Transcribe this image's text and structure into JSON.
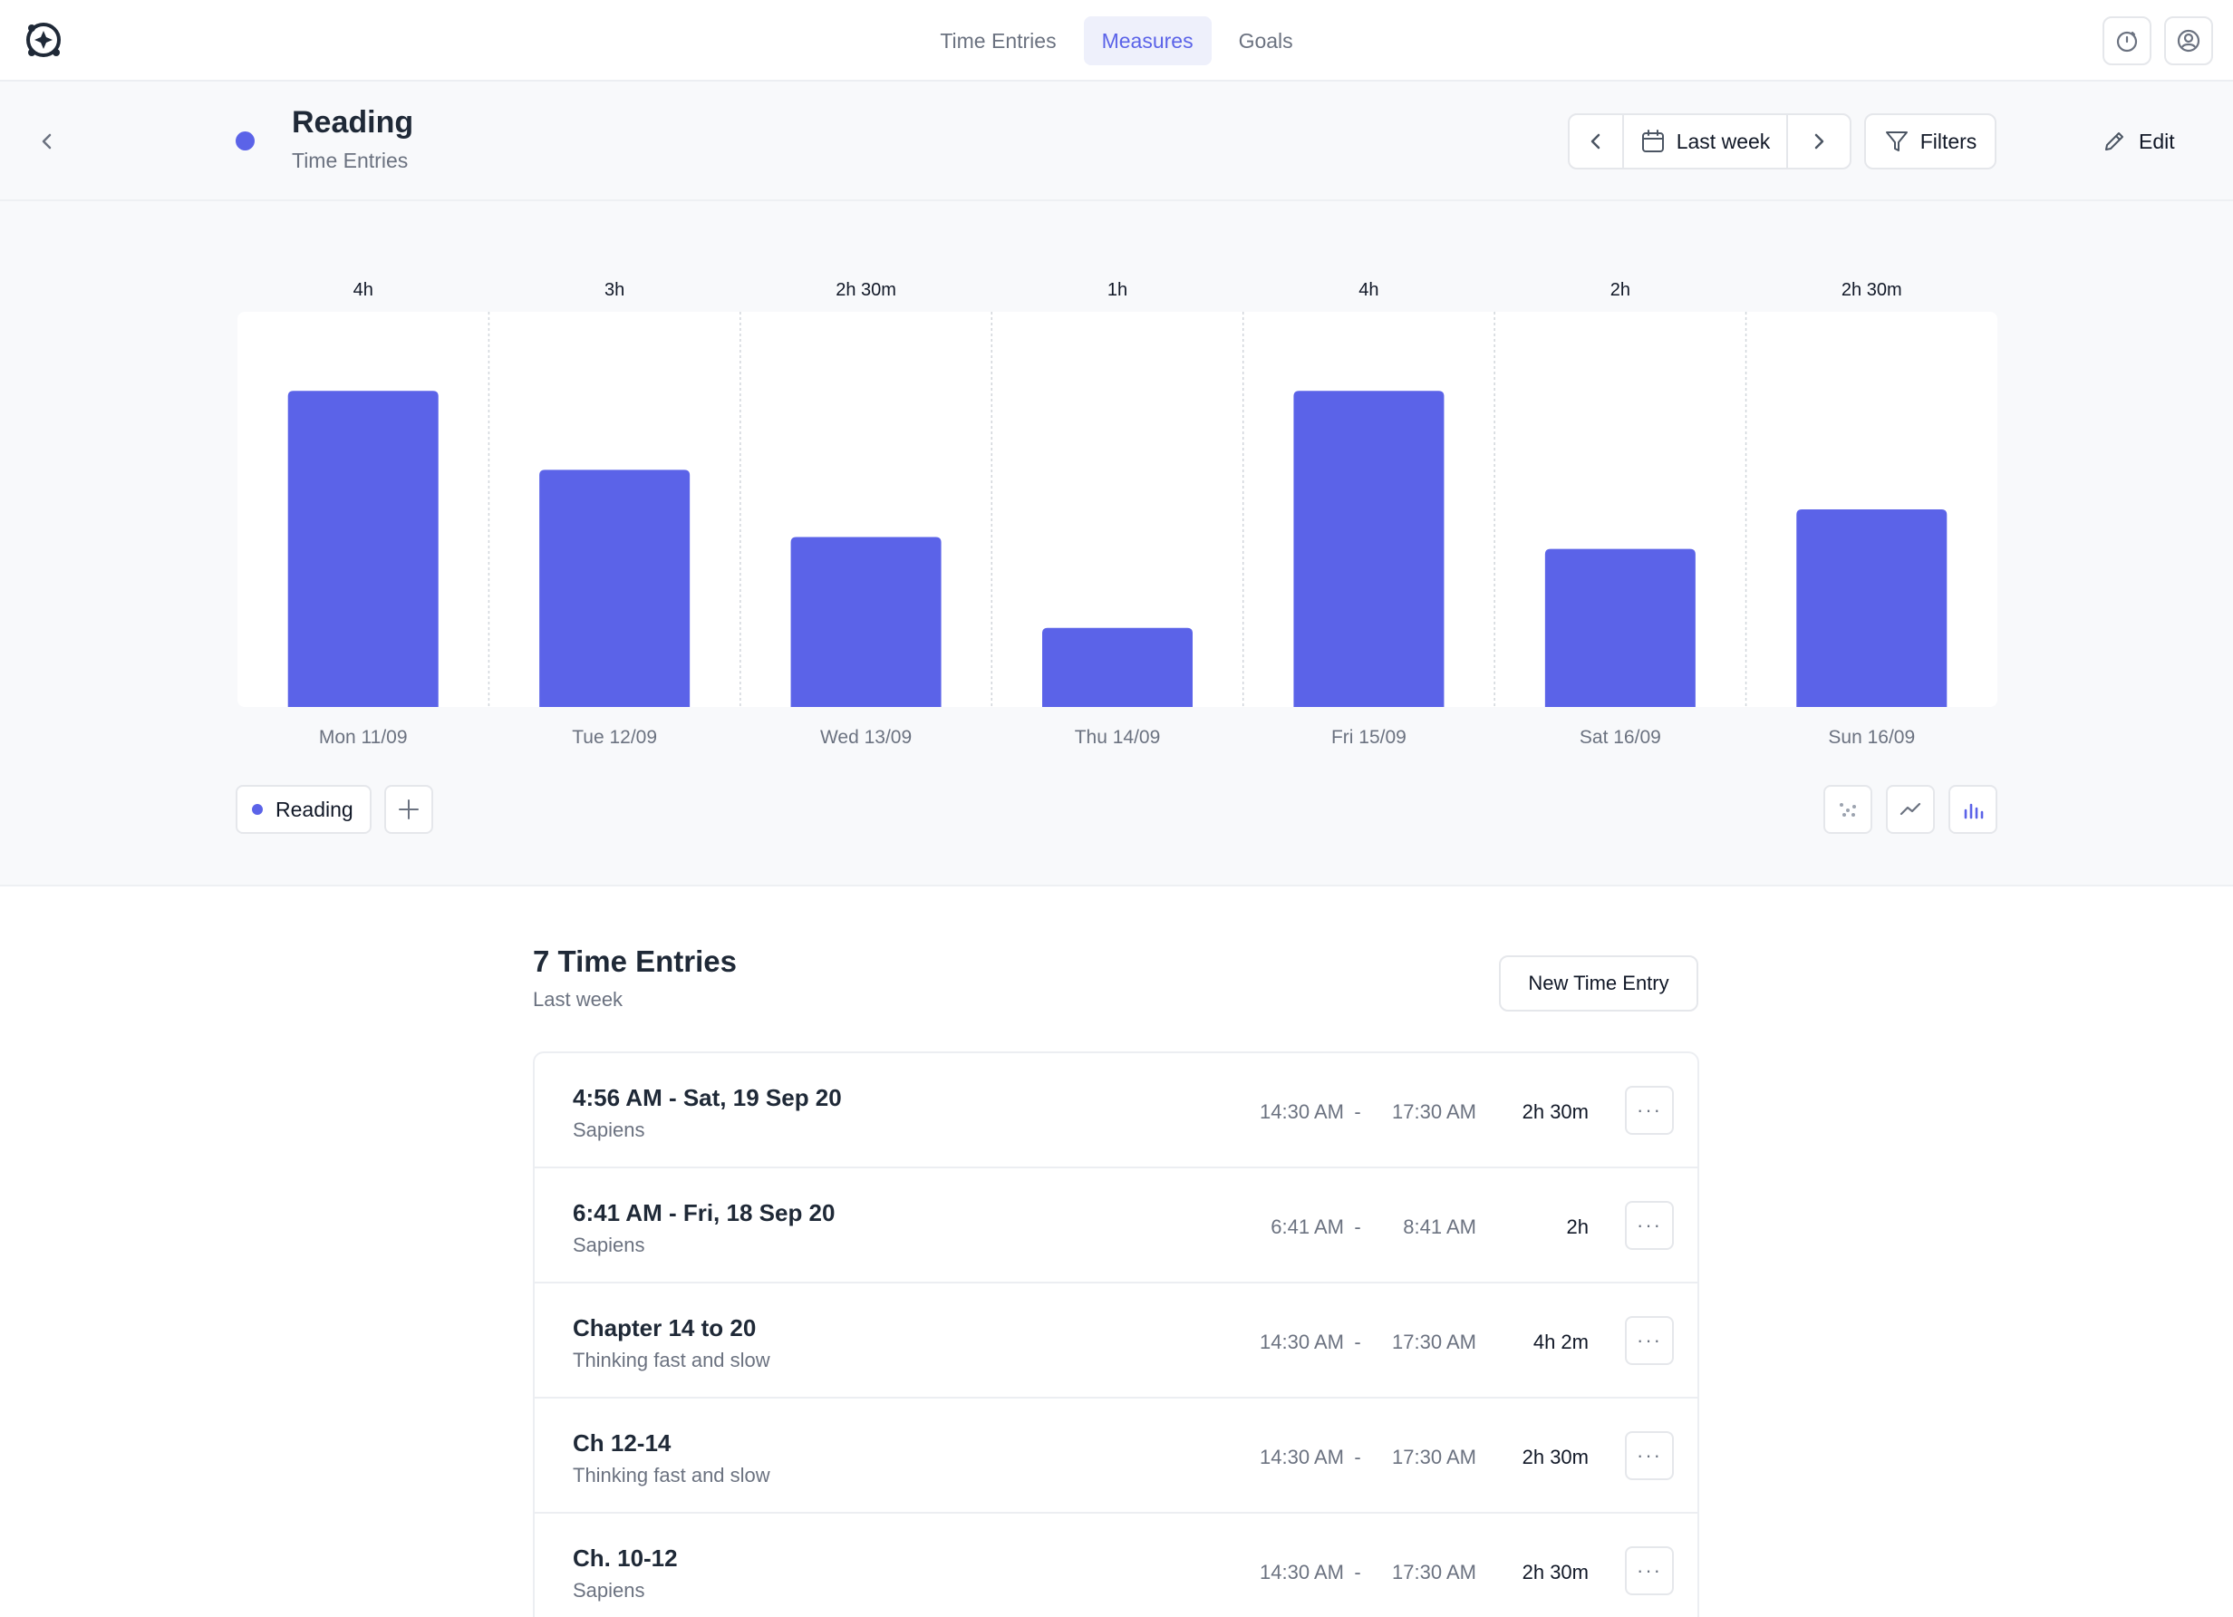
{
  "nav": {
    "tabs": [
      {
        "label": "Time Entries",
        "active": false
      },
      {
        "label": "Measures",
        "active": true
      },
      {
        "label": "Goals",
        "active": false
      }
    ],
    "right_icons": [
      "timer-icon",
      "user-circle-icon"
    ]
  },
  "header": {
    "title": "Reading",
    "subtitle": "Time Entries",
    "dot_color": "#5b63e8",
    "date_range": "Last week",
    "filters_label": "Filters",
    "edit_label": "Edit"
  },
  "chart_data": {
    "type": "bar",
    "categories": [
      "Mon 11/09",
      "Tue 12/09",
      "Wed 13/09",
      "Thu 14/09",
      "Fri 15/09",
      "Sat 16/09",
      "Sun 16/09"
    ],
    "value_labels": [
      "4h",
      "3h",
      "2h 30m",
      "1h",
      "4h",
      "2h",
      "2h 30m"
    ],
    "series": [
      {
        "name": "Reading",
        "color": "#5b63e8",
        "values": [
          4,
          3,
          2.15,
          1,
          4,
          2,
          2.5
        ]
      }
    ],
    "ylim": [
      0,
      5
    ],
    "grid": "vertical dashed separators",
    "chart_types": [
      "scatter",
      "line",
      "bar"
    ],
    "selected_chart_type": "bar"
  },
  "legend": {
    "series_label": "Reading"
  },
  "list": {
    "title": "7 Time Entries",
    "subtitle": "Last week",
    "new_button": "New Time Entry",
    "entries": [
      {
        "title": "4:56 AM - Sat, 19 Sep 20",
        "sub": "Sapiens",
        "start": "14:30 AM",
        "end": "17:30 AM",
        "duration": "2h 30m"
      },
      {
        "title": "6:41 AM - Fri, 18 Sep 20",
        "sub": "Sapiens",
        "start": "6:41 AM",
        "end": "8:41 AM",
        "duration": "2h"
      },
      {
        "title": "Chapter 14 to 20",
        "sub": "Thinking fast and slow",
        "start": "14:30 AM",
        "end": "17:30 AM",
        "duration": "4h 2m"
      },
      {
        "title": "Ch 12-14",
        "sub": "Thinking fast and slow",
        "start": "14:30 AM",
        "end": "17:30 AM",
        "duration": "2h 30m"
      },
      {
        "title": "Ch. 10-12",
        "sub": "Sapiens",
        "start": "14:30 AM",
        "end": "17:30 AM",
        "duration": "2h 30m"
      }
    ],
    "separator": "-",
    "menu_glyph": "···"
  }
}
